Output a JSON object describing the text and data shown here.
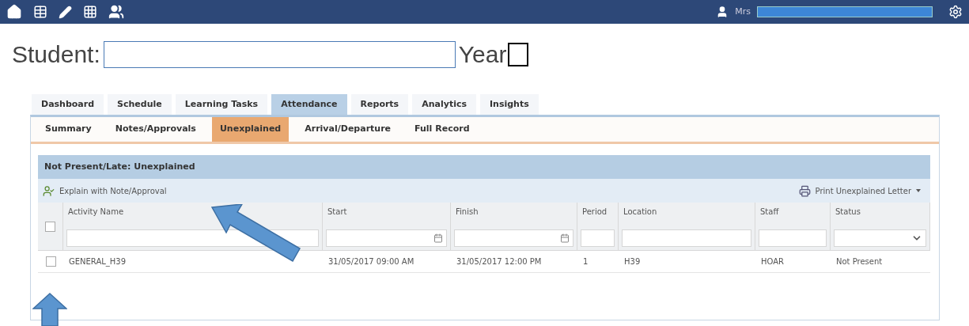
{
  "top_bar": {
    "user_prefix": "Mrs"
  },
  "student": {
    "label": "Student:",
    "year_label": "Year"
  },
  "tabs": [
    {
      "label": "Dashboard",
      "selected": false
    },
    {
      "label": "Schedule",
      "selected": false
    },
    {
      "label": "Learning Tasks",
      "selected": false
    },
    {
      "label": "Attendance",
      "selected": true
    },
    {
      "label": "Reports",
      "selected": false
    },
    {
      "label": "Analytics",
      "selected": false
    },
    {
      "label": "Insights",
      "selected": false
    }
  ],
  "subtabs": [
    {
      "label": "Summary",
      "selected": false
    },
    {
      "label": "Notes/Approvals",
      "selected": false
    },
    {
      "label": "Unexplained",
      "selected": true
    },
    {
      "label": "Arrival/Departure",
      "selected": false
    },
    {
      "label": "Full Record",
      "selected": false
    }
  ],
  "grid": {
    "title": "Not Present/Late: Unexplained",
    "toolbar": {
      "left": "Explain with Note/Approval",
      "right": "Print Unexplained Letter"
    },
    "select_all_checked": false,
    "columns": [
      {
        "label": "Activity Name",
        "kind": "text"
      },
      {
        "label": "Start",
        "kind": "date"
      },
      {
        "label": "Finish",
        "kind": "date"
      },
      {
        "label": "Period",
        "kind": "text"
      },
      {
        "label": "Location",
        "kind": "text"
      },
      {
        "label": "Staff",
        "kind": "text"
      },
      {
        "label": "Status",
        "kind": "select"
      }
    ],
    "rows": [
      {
        "checked": false,
        "cells": [
          "GENERAL_H39",
          "31/05/2017 09:00 AM",
          "31/05/2017 12:00 PM",
          "1",
          "H39",
          "HOAR",
          "Not Present"
        ]
      }
    ]
  }
}
